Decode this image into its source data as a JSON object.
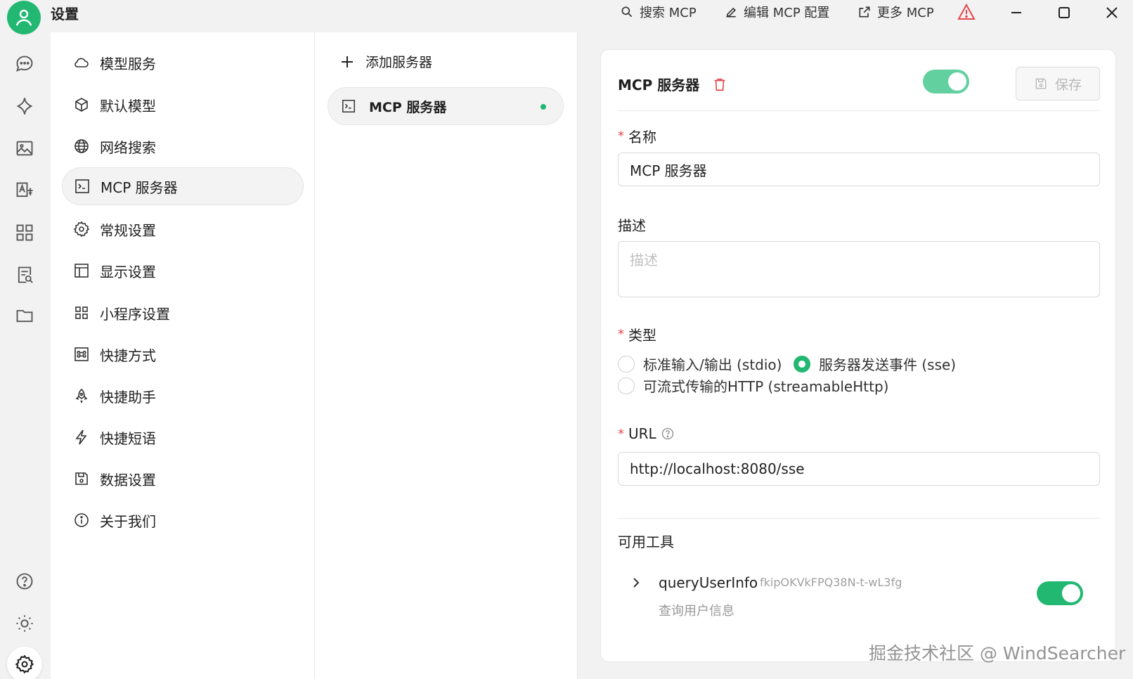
{
  "app": {
    "title": "设置",
    "accent_color": "#22b872"
  },
  "titlebar": {
    "search_mcp": "搜索 MCP",
    "edit_mcp_config": "编辑 MCP 配置",
    "more_mcp": "更多 MCP",
    "warning_icon": "warning-triangle-icon"
  },
  "rail": {
    "icons": [
      "chat-bubble-icon",
      "sparkle-icon",
      "image-icon",
      "translate-icon",
      "apps-grid-icon",
      "document-search-icon",
      "folder-icon",
      "help-circle-icon",
      "sun-icon",
      "gear-icon"
    ]
  },
  "menu": {
    "items": [
      {
        "label": "模型服务",
        "icon": "cloud-icon"
      },
      {
        "label": "默认模型",
        "icon": "cube-icon"
      },
      {
        "label": "网络搜索",
        "icon": "globe-icon"
      },
      {
        "label": "MCP 服务器",
        "icon": "terminal-icon",
        "active": true
      },
      {
        "label": "常规设置",
        "icon": "gear-icon"
      },
      {
        "label": "显示设置",
        "icon": "layout-icon"
      },
      {
        "label": "小程序设置",
        "icon": "apps-grid-icon"
      },
      {
        "label": "快捷方式",
        "icon": "command-key-icon"
      },
      {
        "label": "快捷助手",
        "icon": "rocket-icon"
      },
      {
        "label": "快捷短语",
        "icon": "lightning-icon"
      },
      {
        "label": "数据设置",
        "icon": "save-disk-icon"
      },
      {
        "label": "关于我们",
        "icon": "info-circle-icon"
      }
    ]
  },
  "servers": {
    "add_label": "添加服务器",
    "items": [
      {
        "label": "MCP 服务器",
        "status": "active"
      }
    ]
  },
  "detail": {
    "title": "MCP 服务器",
    "enabled": true,
    "save_label": "保存",
    "name_label": "名称",
    "name_value": "MCP 服务器",
    "desc_label": "描述",
    "desc_placeholder": "描述",
    "type_label": "类型",
    "type_options": [
      "标准输入/输出 (stdio)",
      "服务器发送事件 (sse)",
      "可流式传输的HTTP (streamableHttp)"
    ],
    "type_selected": "服务器发送事件 (sse)",
    "url_label": "URL",
    "url_value": "http://localhost:8080/sse",
    "tools_label": "可用工具",
    "tools": [
      {
        "name": "queryUserInfo",
        "id": "fkipOKVkFPQ38N-t-wL3fg",
        "description": "查询用户信息",
        "enabled": true
      }
    ]
  },
  "watermark": "掘金技术社区 @ WindSearcher"
}
